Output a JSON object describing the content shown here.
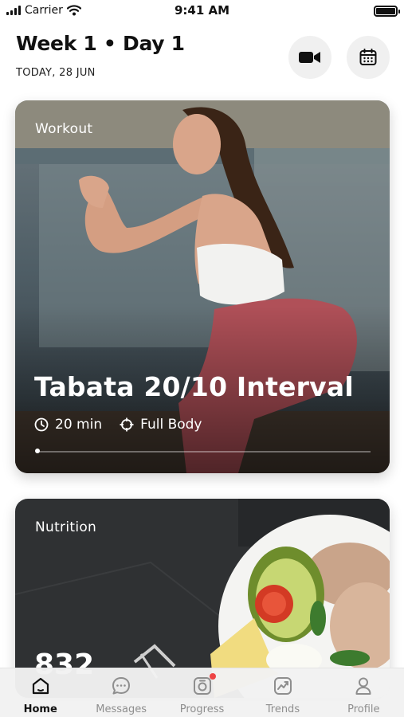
{
  "status_bar": {
    "carrier": "Carrier",
    "time": "9:41 AM",
    "icons": [
      "signal-icon",
      "wifi-icon",
      "battery-icon"
    ]
  },
  "header": {
    "title": "Week 1 • Day 1",
    "date": "TODAY, 28 JUN",
    "actions": [
      "video-camera-icon",
      "calendar-icon"
    ]
  },
  "workout_card": {
    "label": "Workout",
    "title": "Tabata 20/10 Interval",
    "duration": "20 min",
    "focus": "Full Body",
    "icons": [
      "clock-icon",
      "target-icon"
    ]
  },
  "nutrition_card": {
    "label": "Nutrition",
    "calories": "832"
  },
  "nav": {
    "items": [
      {
        "label": "Home",
        "icon": "home-icon",
        "active": true
      },
      {
        "label": "Messages",
        "icon": "chat-icon"
      },
      {
        "label": "Progress",
        "icon": "camera-progress-icon",
        "badge": true
      },
      {
        "label": "Trends",
        "icon": "trend-chart-icon"
      },
      {
        "label": "Profile",
        "icon": "user-icon"
      }
    ]
  },
  "colors": {
    "accent_dark": "#111111",
    "inactive": "#8e8e8e",
    "badge": "#ee4444"
  }
}
